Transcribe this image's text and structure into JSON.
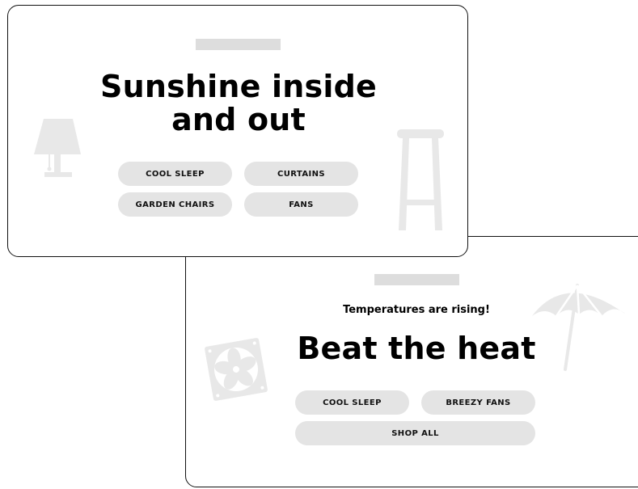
{
  "cards": [
    {
      "headline_line1": "Sunshine inside",
      "headline_line2": "and out",
      "buttons": [
        "COOL SLEEP",
        "CURTAINS",
        "GARDEN CHAIRS",
        "FANS"
      ]
    },
    {
      "subhead": "Temperatures are rising!",
      "headline": "Beat the heat",
      "buttons": [
        "COOL SLEEP",
        "BREEZY FANS",
        "SHOP ALL"
      ]
    }
  ],
  "colors": {
    "card_border": "#111111",
    "pill_background": "#e4e4e4",
    "eyebrow_bar": "#dddddd",
    "decor": "#e6e6e6",
    "text": "#000000"
  },
  "icons": [
    "lamp-icon",
    "bar-stool-icon",
    "fan-icon",
    "beach-umbrella-icon"
  ]
}
